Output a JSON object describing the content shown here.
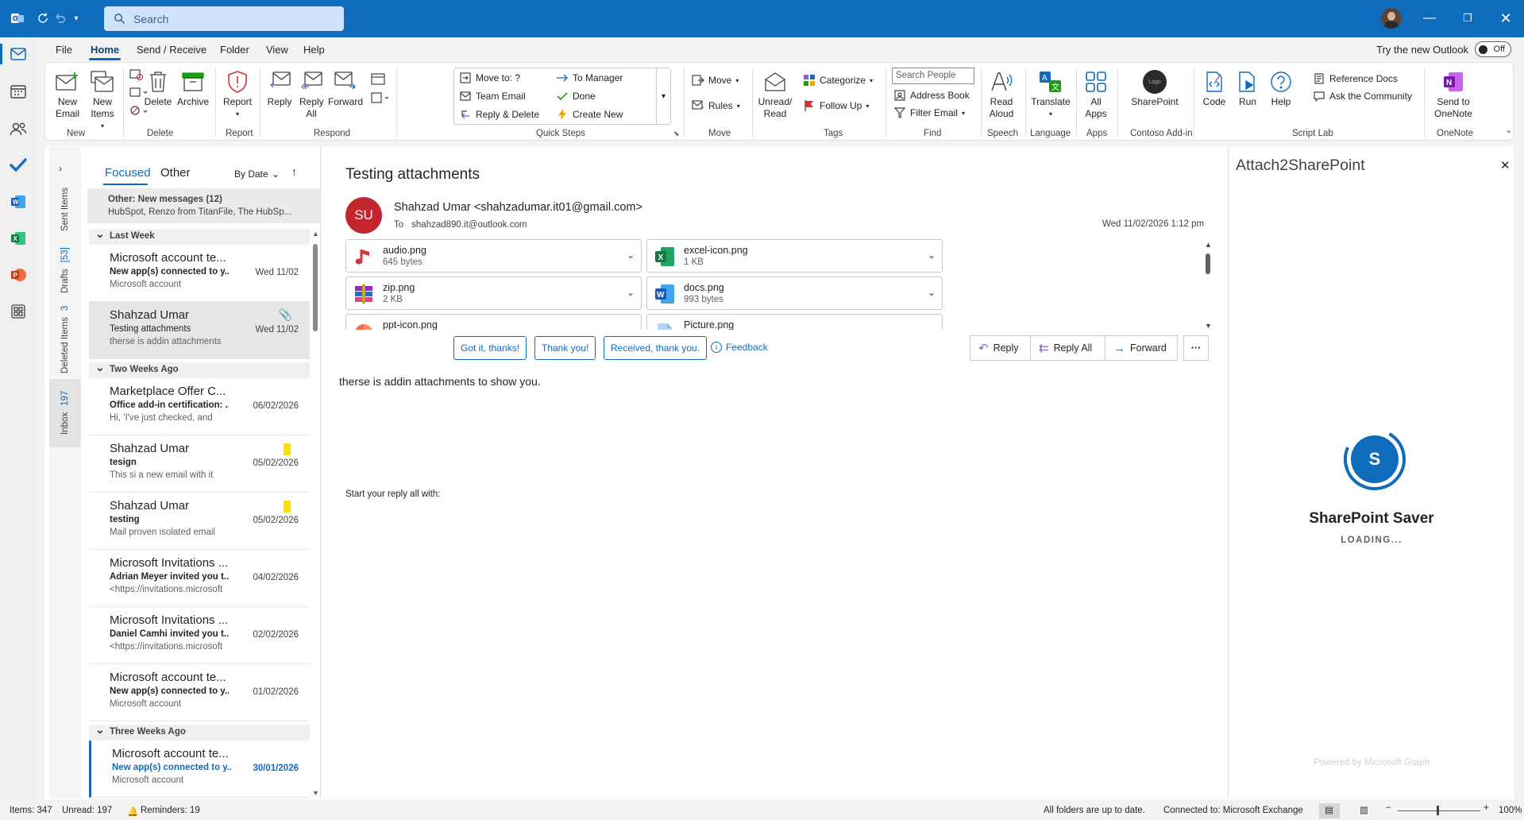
{
  "titlebar": {
    "search_placeholder": "Search"
  },
  "menu": {
    "tabs": [
      "File",
      "Home",
      "Send / Receive",
      "Folder",
      "View",
      "Help"
    ],
    "try_new": "Try the new Outlook",
    "toggle": "Off"
  },
  "ribbon": {
    "new_email": "New Email",
    "new_items": "New Items",
    "group_new": "New",
    "delete": "Delete",
    "archive": "Archive",
    "group_delete": "Delete",
    "report": "Report",
    "group_report": "Report",
    "reply": "Reply",
    "reply_all": "Reply All",
    "forward": "Forward",
    "group_respond": "Respond",
    "qs": [
      "Move to: ?",
      "Team Email",
      "Reply & Delete",
      "To Manager",
      "Done",
      "Create New"
    ],
    "group_qs": "Quick Steps",
    "move": "Move",
    "rules": "Rules",
    "group_move": "Move",
    "unread": "Unread/ Read",
    "categorize": "Categorize",
    "follow_up": "Follow Up",
    "group_tags": "Tags",
    "search_people": "Search People",
    "address_book": "Address Book",
    "filter_email": "Filter Email",
    "group_find": "Find",
    "read_aloud": "Read Aloud",
    "group_speech": "Speech",
    "translate": "Translate",
    "group_language": "Language",
    "all_apps": "All Apps",
    "group_apps": "Apps",
    "sharepoint": "SharePoint",
    "logo_text": "Logo",
    "group_contoso": "Contoso Add-in",
    "code": "Code",
    "run": "Run",
    "help": "Help",
    "ref_docs": "Reference Docs",
    "ask_comm": "Ask the Community",
    "group_script": "Script Lab",
    "send_onenote": "Send to OneNote",
    "group_onenote": "OneNote"
  },
  "folders": {
    "sent": "Sent Items",
    "drafts": "Drafts",
    "drafts_count": "[53]",
    "deleted": "Deleted Items",
    "deleted_count": "3",
    "inbox": "Inbox",
    "inbox_count": "197"
  },
  "list": {
    "focused": "Focused",
    "other": "Other",
    "sort": "By Date",
    "other_banner_title": "Other: New messages (12)",
    "other_banner_text": "HubSpot, Renzo from TitanFile, The HubSp...",
    "groups": [
      "Last Week",
      "Two Weeks Ago",
      "Three Weeks Ago"
    ],
    "messages": [
      {
        "from": "Microsoft account te...",
        "subject": "New app(s) connected to y...",
        "preview": "Microsoft account",
        "date": "Wed 11/02"
      },
      {
        "from": "Shahzad Umar",
        "subject": "Testing attachments",
        "preview": "therse is addin attachments",
        "date": "Wed 11/02"
      },
      {
        "from": "Marketplace Offer C...",
        "subject": "Office add-in certification: ...",
        "preview": "Hi,  'I've just checked, and",
        "date": "06/02/2026"
      },
      {
        "from": "Shahzad Umar",
        "subject": "tesign",
        "preview": "This si a new email with it",
        "date": "05/02/2026"
      },
      {
        "from": "Shahzad Umar",
        "subject": "testing",
        "preview": "Mail proven isolated email",
        "date": "05/02/2026"
      },
      {
        "from": "Microsoft Invitations ...",
        "subject": "Adrian Meyer invited you t...",
        "preview": "<https://invitations.microsoft",
        "date": "04/02/2026"
      },
      {
        "from": "Microsoft Invitations ...",
        "subject": "Daniel  Camhi invited you t...",
        "preview": "<https://invitations.microsoft",
        "date": "02/02/2026"
      },
      {
        "from": "Microsoft account te...",
        "subject": "New app(s) connected to y...",
        "preview": "Microsoft account",
        "date": "01/02/2026"
      },
      {
        "from": "Microsoft account te...",
        "subject": "New app(s) connected to y...",
        "preview": "Microsoft account",
        "date": "30/01/2026"
      }
    ]
  },
  "email": {
    "subject": "Testing attachments",
    "avatar": "SU",
    "from": "Shahzad Umar <shahzadumar.it01@gmail.com>",
    "to_label": "To",
    "to": "shahzad890.it@outlook.com",
    "date": "Wed 11/02/2026 1:12 pm",
    "reply": "Reply",
    "reply_all": "Reply All",
    "forward": "Forward",
    "attachments": [
      {
        "name": "audio.png",
        "size": "645 bytes"
      },
      {
        "name": "excel-icon.png",
        "size": "1 KB"
      },
      {
        "name": "zip.png",
        "size": "2 KB"
      },
      {
        "name": "docs.png",
        "size": "993 bytes"
      },
      {
        "name": "ppt-icon.png",
        "size": ""
      },
      {
        "name": "Picture.png",
        "size": ""
      }
    ],
    "reply_prompt": "Start your reply all with:",
    "suggestions": [
      "Got it, thanks!",
      "Thank you!",
      "Received, thank you."
    ],
    "feedback": "Feedback",
    "body": "therse is addin attachments to show you."
  },
  "addin": {
    "title": "Attach2SharePoint",
    "avatar": "S",
    "name": "SharePoint Saver",
    "loading": "LOADING...",
    "powered": "Powered by Microsoft Graph"
  },
  "status": {
    "items": "Items: 347",
    "unread": "Unread: 197",
    "reminders": "Reminders: 19",
    "sync": "All folders are up to date.",
    "conn": "Connected to: Microsoft Exchange",
    "zoom": "100%"
  }
}
